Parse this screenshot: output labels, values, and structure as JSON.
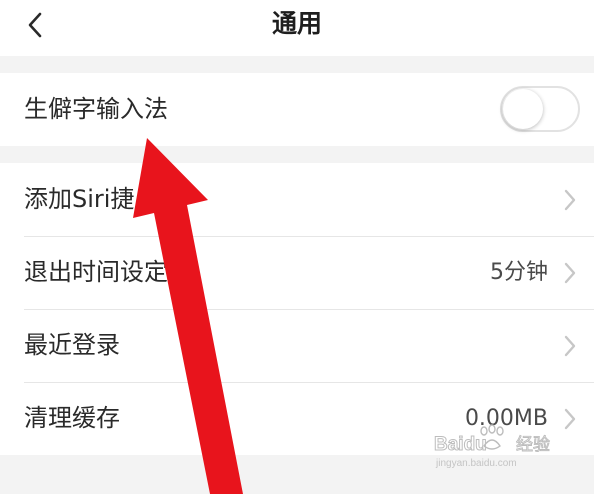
{
  "header": {
    "title": "通用",
    "back_icon": "chevron-left-icon"
  },
  "toggle_row": {
    "label": "生僻字输入法",
    "enabled": false
  },
  "rows": [
    {
      "label": "添加Siri捷",
      "value": "",
      "chevron_icon": "chevron-right-icon"
    },
    {
      "label": "退出时间设定",
      "value": "5分钟",
      "chevron_icon": "chevron-right-icon"
    },
    {
      "label": "最近登录",
      "value": "",
      "chevron_icon": "chevron-right-icon"
    },
    {
      "label": "清理缓存",
      "value": "0.00MB",
      "chevron_icon": "chevron-right-icon"
    }
  ],
  "watermark": {
    "brand": "Baidu",
    "cn": "经验",
    "sub": "jingyan.baidu.com"
  },
  "annotation": {
    "arrow_color": "#e8141c"
  },
  "colors": {
    "background": "#f3f3f3",
    "card": "#ffffff",
    "divider": "#e6e6e6",
    "text": "#2a2a2a",
    "chevron": "#c7c7c7"
  }
}
